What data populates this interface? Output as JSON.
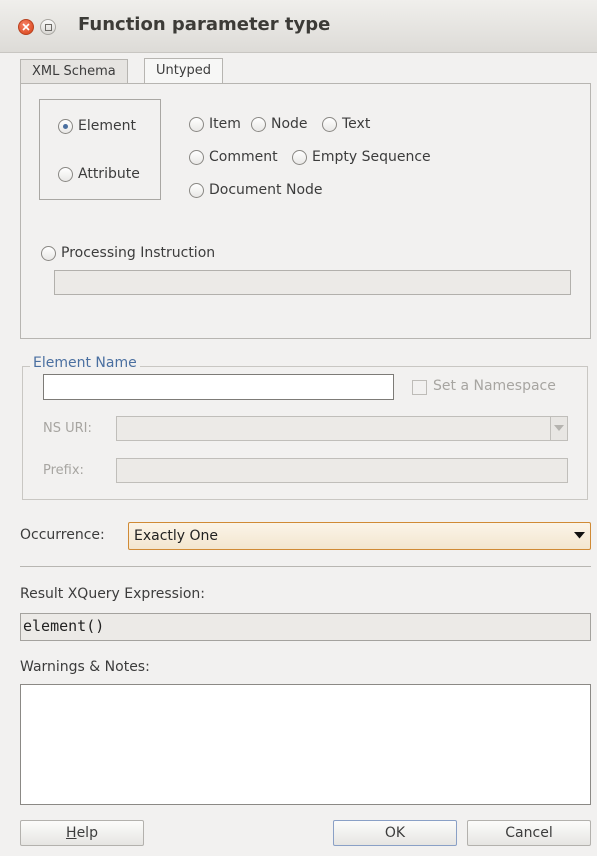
{
  "window": {
    "title": "Function parameter type"
  },
  "tabs": [
    {
      "label": "XML Schema",
      "active": false
    },
    {
      "label": "Untyped",
      "active": true
    }
  ],
  "kind": {
    "options": [
      {
        "label": "Element",
        "checked": true
      },
      {
        "label": "Attribute",
        "checked": false
      }
    ]
  },
  "node_types": {
    "row1": [
      "Item",
      "Node",
      "Text"
    ],
    "row2": [
      "Comment",
      "Empty Sequence"
    ],
    "row3": [
      "Document Node"
    ],
    "processing_instruction": "Processing Instruction",
    "pi_value": ""
  },
  "element_name": {
    "legend": "Element Name",
    "value": "",
    "namespace_checkbox": "Set a Namespace",
    "ns_uri_label": "NS URI:",
    "ns_uri_value": "",
    "prefix_label": "Prefix:",
    "prefix_value": ""
  },
  "occurrence": {
    "label": "Occurrence:",
    "value": "Exactly One"
  },
  "result": {
    "label": "Result XQuery Expression:",
    "value": "element()"
  },
  "warnings": {
    "label": "Warnings & Notes:",
    "value": ""
  },
  "buttons": {
    "help_mnemonic": "H",
    "help_rest": "elp",
    "ok": "OK",
    "cancel": "Cancel"
  },
  "colors": {
    "accent": "#4a6fa0",
    "occurrence_border": "#d08a35",
    "close_button": "#e0532b"
  }
}
